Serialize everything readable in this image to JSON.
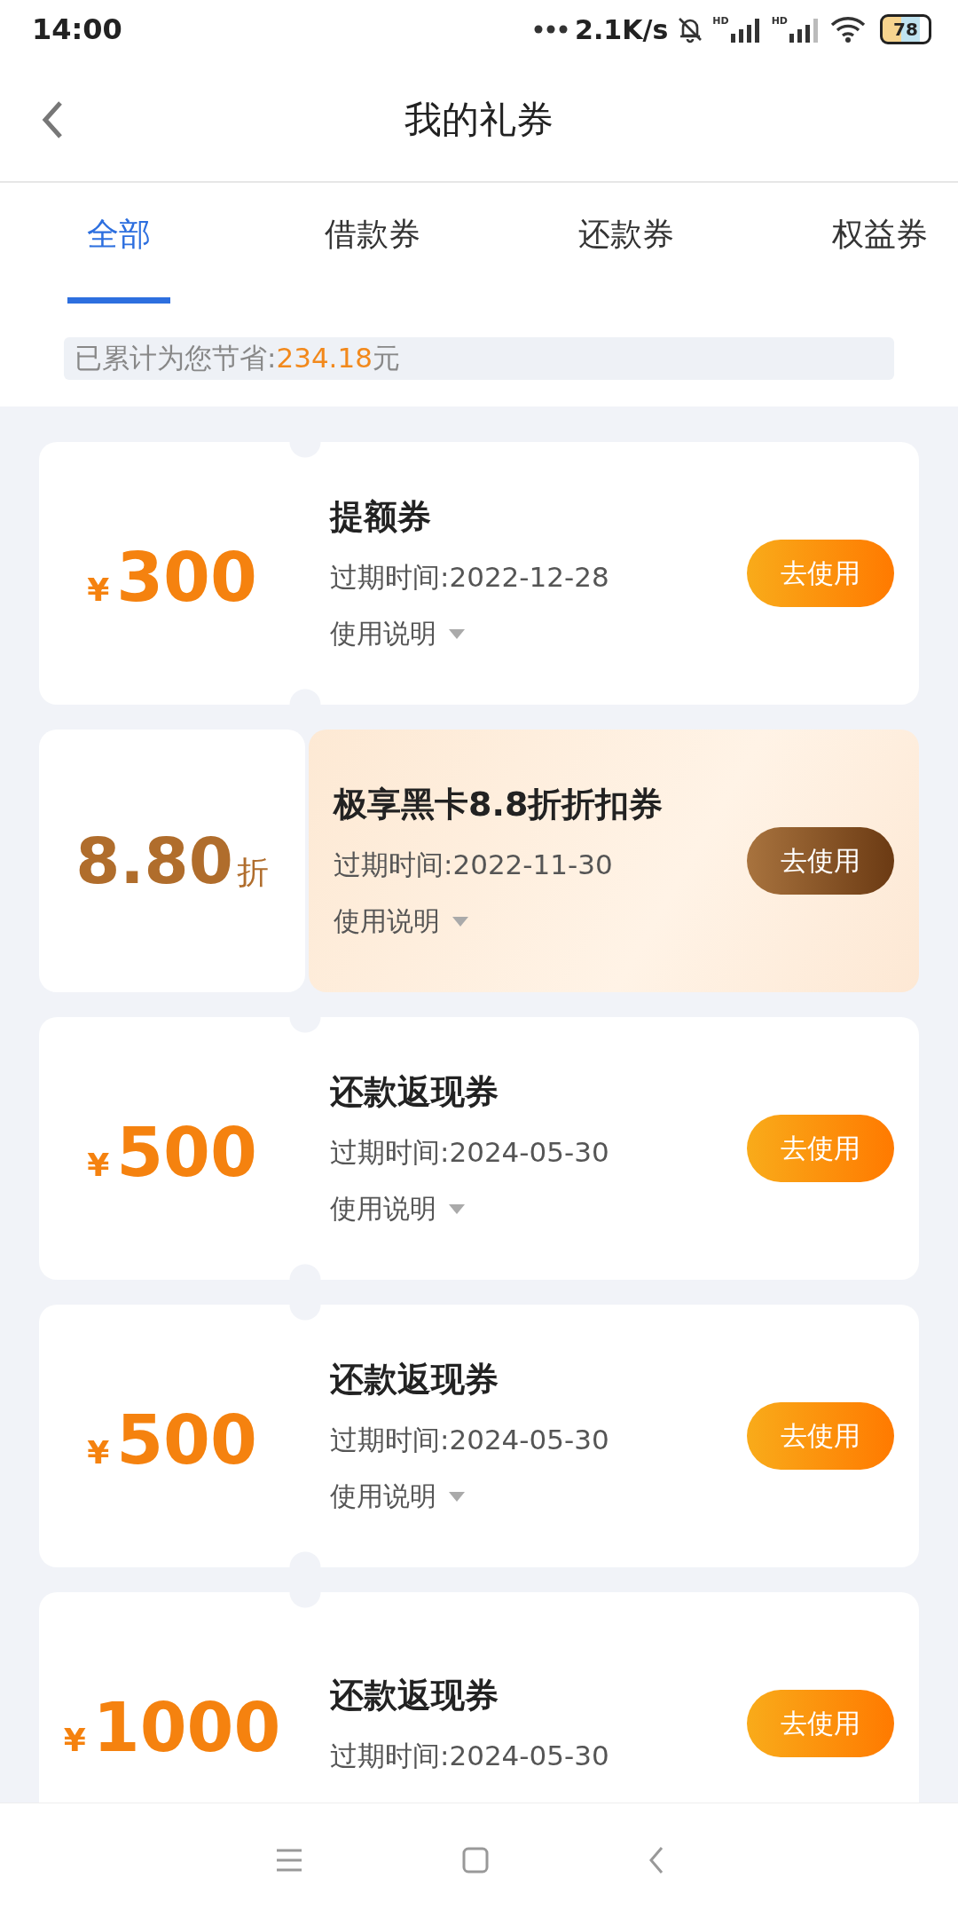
{
  "status_bar": {
    "time": "14:00",
    "speed": "2.1K/s",
    "sim_labels": [
      "HD",
      "HD"
    ],
    "battery": "78"
  },
  "header": {
    "title": "我的礼券"
  },
  "tabs": [
    {
      "label": "全部",
      "selected": true
    },
    {
      "label": "借款券",
      "selected": false
    },
    {
      "label": "还款券",
      "selected": false
    },
    {
      "label": "权益券",
      "selected": false
    }
  ],
  "savings": {
    "label": "已累计为您节省:",
    "amount": "234.18",
    "unit": "元"
  },
  "coupons": [
    {
      "kind": "cash",
      "currency": "¥",
      "value": "300",
      "title": "提额券",
      "expiry": "过期时间:2022-12-28",
      "note": "使用说明",
      "button": "去使用"
    },
    {
      "kind": "discount",
      "value": "8.80",
      "unit": "折",
      "title": "极享黑卡8.8折折扣券",
      "expiry": "过期时间:2022-11-30",
      "note": "使用说明",
      "button": "去使用"
    },
    {
      "kind": "cash",
      "currency": "¥",
      "value": "500",
      "title": "还款返现券",
      "expiry": "过期时间:2024-05-30",
      "note": "使用说明",
      "button": "去使用"
    },
    {
      "kind": "cash",
      "currency": "¥",
      "value": "500",
      "title": "还款返现券",
      "expiry": "过期时间:2024-05-30",
      "note": "使用说明",
      "button": "去使用"
    },
    {
      "kind": "cash",
      "currency": "¥",
      "value": "1000",
      "title": "还款返现券",
      "expiry": "过期时间:2024-05-30",
      "button": "去使用"
    }
  ]
}
